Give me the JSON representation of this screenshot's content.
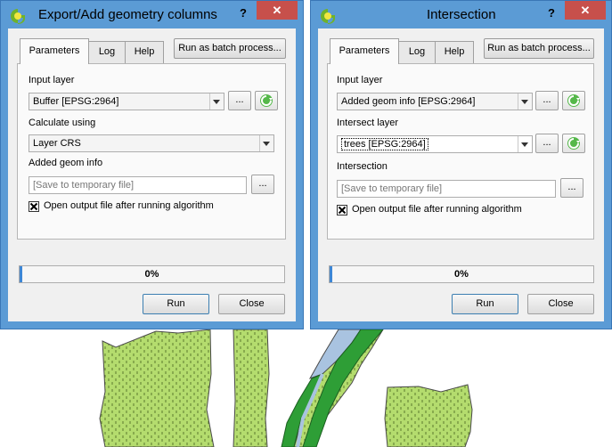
{
  "dialogs": [
    {
      "title": "Export/Add geometry columns",
      "help": "?",
      "close": "✕",
      "tabs": [
        "Parameters",
        "Log",
        "Help"
      ],
      "batch_label": "Run as batch process...",
      "input_label": "Input layer",
      "input_value": "Buffer [EPSG:2964]",
      "second_label": "Calculate using",
      "second_value": "Layer CRS",
      "output_label": "Added geom info",
      "output_placeholder": "[Save to temporary file]",
      "browse": "...",
      "checkbox_label": "Open output file after running algorithm",
      "checkbox_checked": true,
      "progress": 0,
      "progress_text": "0%",
      "run": "Run",
      "close_button": "Close"
    },
    {
      "title": "Intersection",
      "help": "?",
      "close": "✕",
      "tabs": [
        "Parameters",
        "Log",
        "Help"
      ],
      "batch_label": "Run as batch process...",
      "input_label": "Input layer",
      "input_value": "Added geom info [EPSG:2964]",
      "second_label": "Intersect layer",
      "second_value": "trees [EPSG:2964]",
      "output_label": "Intersection",
      "output_placeholder": "[Save to temporary file]",
      "browse": "...",
      "checkbox_label": "Open output file after running algorithm",
      "checkbox_checked": true,
      "progress": 0,
      "progress_text": "0%",
      "run": "Run",
      "close_button": "Close"
    }
  ],
  "colors": {
    "titlebar": "#5b9bd5",
    "close_button": "#c7504b",
    "tree_fill": "#b4dc6e",
    "buffer_band": "#2e9e36",
    "river": "#a9c3e0"
  }
}
